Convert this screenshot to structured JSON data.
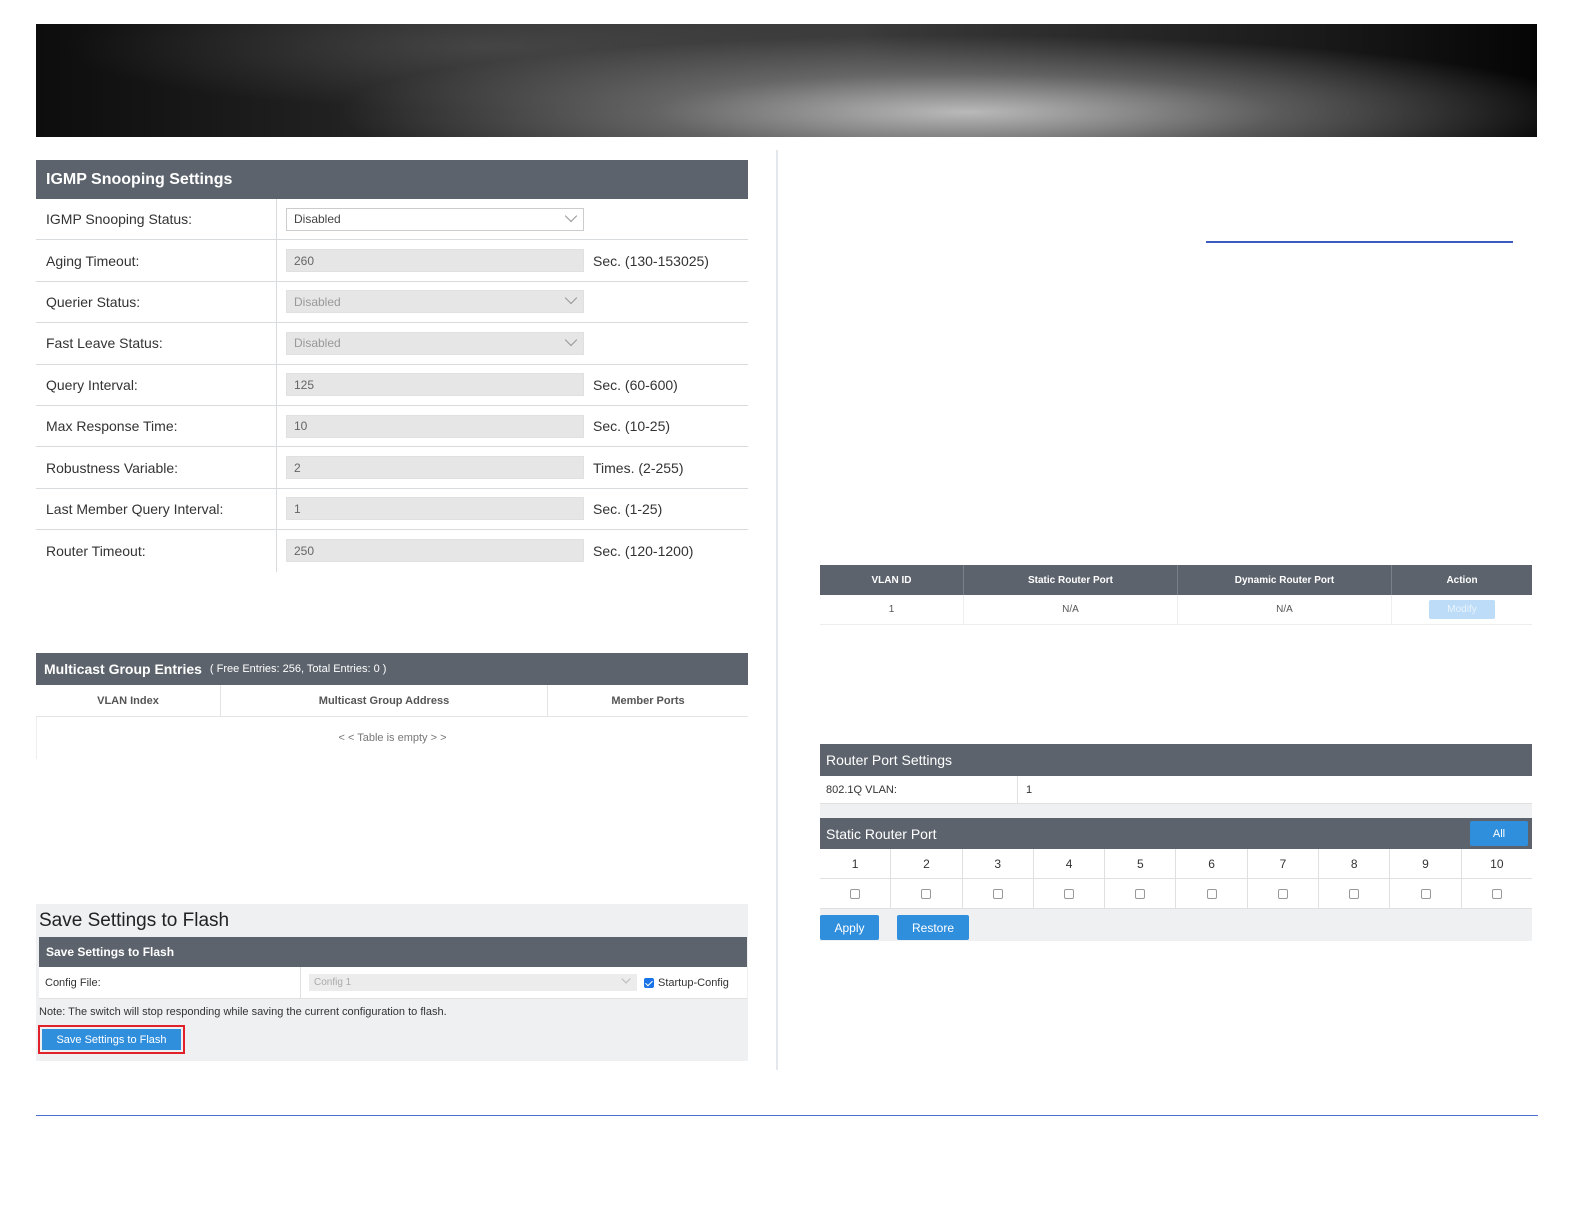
{
  "igmp": {
    "title": "IGMP Snooping Settings",
    "rows": [
      {
        "label": "IGMP Snooping Status:",
        "value": "Disabled",
        "unit": ""
      },
      {
        "label": "Aging Timeout:",
        "value": "260",
        "unit": "Sec. (130-153025)"
      },
      {
        "label": "Querier Status:",
        "value": "Disabled",
        "unit": ""
      },
      {
        "label": "Fast Leave Status:",
        "value": "Disabled",
        "unit": ""
      },
      {
        "label": "Query Interval:",
        "value": "125",
        "unit": "Sec. (60-600)"
      },
      {
        "label": "Max Response Time:",
        "value": "10",
        "unit": "Sec. (10-25)"
      },
      {
        "label": "Robustness Variable:",
        "value": "2",
        "unit": "Times. (2-255)"
      },
      {
        "label": "Last Member Query Interval:",
        "value": "1",
        "unit": "Sec. (1-25)"
      },
      {
        "label": "Router Timeout:",
        "value": "250",
        "unit": "Sec. (120-1200)"
      }
    ]
  },
  "multicast": {
    "title": "Multicast Group Entries",
    "subtitle": "( Free Entries: 256, Total Entries: 0 )",
    "columns": [
      "VLAN Index",
      "Multicast Group Address",
      "Member Ports"
    ],
    "empty_text": "< < Table is empty > >"
  },
  "save": {
    "title": "Save Settings to Flash",
    "panel_title": "Save Settings to Flash",
    "config_label": "Config File:",
    "config_value": "Config 1",
    "startup_label": "Startup-Config",
    "note": "Note: The switch will stop responding while saving the current configuration to flash.",
    "button_label": "Save Settings to Flash"
  },
  "router_table": {
    "columns": [
      "VLAN ID",
      "Static Router Port",
      "Dynamic Router Port",
      "Action"
    ],
    "row": {
      "vlan_id": "1",
      "static": "N/A",
      "dynamic": "N/A",
      "action": "Modify"
    }
  },
  "router_port_settings": {
    "title": "Router Port Settings",
    "vlan_label": "802.1Q VLAN:",
    "vlan_value": "1",
    "static_title": "Static Router Port",
    "all_label": "All",
    "ports": [
      "1",
      "2",
      "3",
      "4",
      "5",
      "6",
      "7",
      "8",
      "9",
      "10"
    ],
    "apply_label": "Apply",
    "restore_label": "Restore"
  },
  "colors": {
    "panel_header": "#5c636c",
    "button_blue": "#2f8fdd",
    "highlight_red": "#e0202a",
    "link_blue": "#3b5bbf"
  }
}
